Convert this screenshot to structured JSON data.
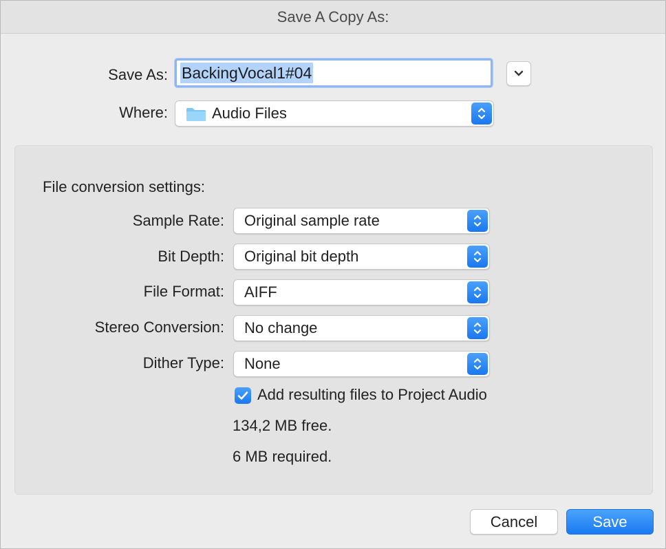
{
  "window": {
    "title": "Save A Copy As:"
  },
  "save_as": {
    "label": "Save As:",
    "value": "BackingVocal1#04"
  },
  "where": {
    "label": "Where:",
    "value": "Audio Files"
  },
  "conversion": {
    "title": "File conversion settings:",
    "sample_rate": {
      "label": "Sample Rate:",
      "value": "Original sample rate"
    },
    "bit_depth": {
      "label": "Bit Depth:",
      "value": "Original bit depth"
    },
    "file_format": {
      "label": "File Format:",
      "value": "AIFF"
    },
    "stereo_conversion": {
      "label": "Stereo Conversion:",
      "value": "No change"
    },
    "dither_type": {
      "label": "Dither Type:",
      "value": "None"
    },
    "add_to_project": {
      "label": "Add resulting files to Project Audio",
      "checked": true
    },
    "free_space": "134,2 MB free.",
    "required_space": "6 MB required."
  },
  "buttons": {
    "cancel": "Cancel",
    "save": "Save"
  },
  "icons": {
    "expand": "chevron-down-icon",
    "folder": "folder-icon",
    "stepper": "up-down-chevron-icon",
    "checkmark": "checkmark-icon"
  },
  "colors": {
    "accent": "#1a78f0",
    "folder": "#7cc6f5",
    "selection": "#b3d3fb"
  }
}
